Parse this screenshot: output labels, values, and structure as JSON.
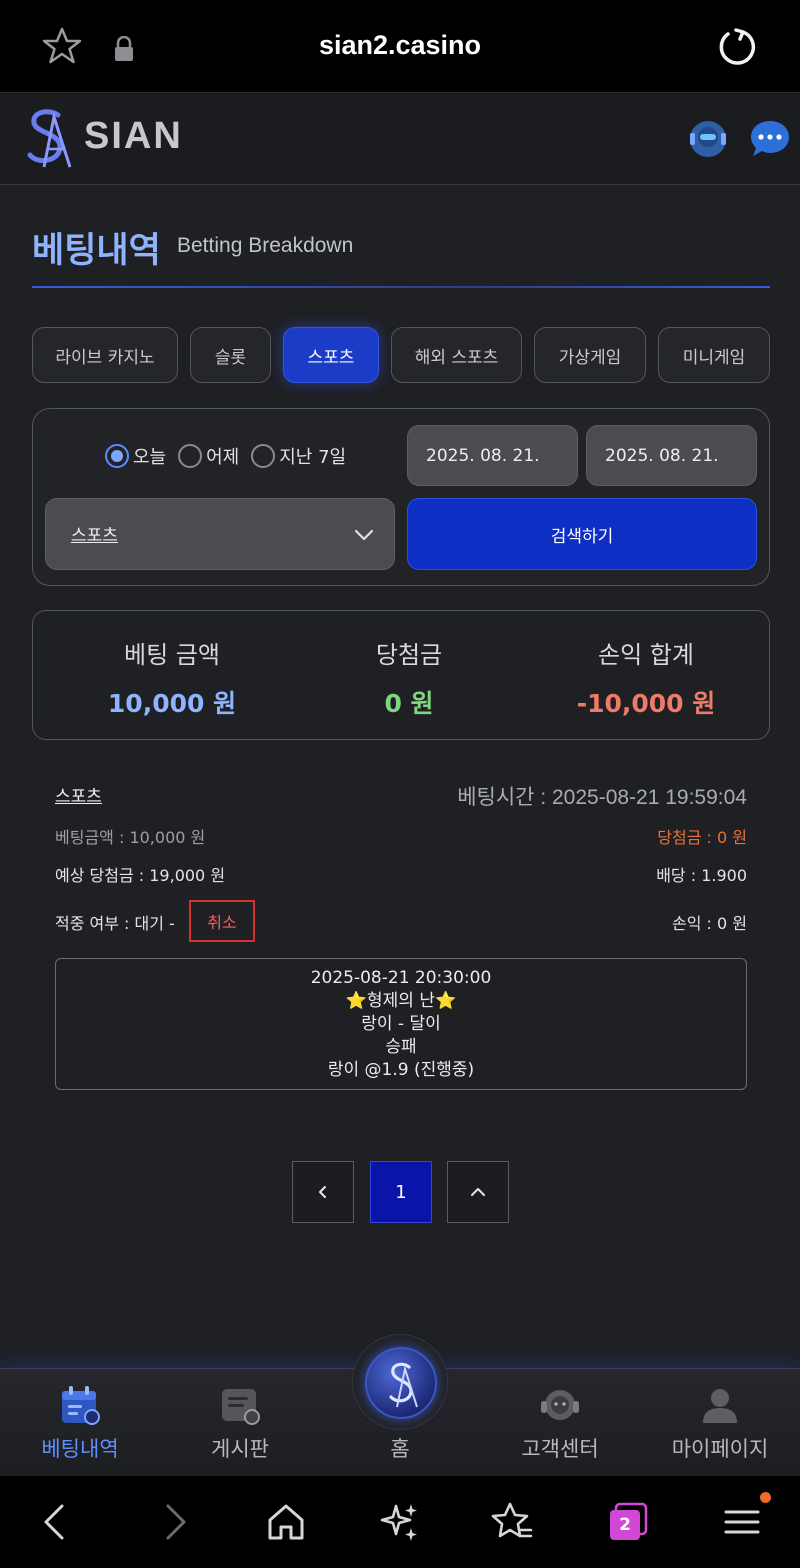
{
  "browser": {
    "url": "sian2.casino",
    "tab_count": "2"
  },
  "site": {
    "logo_text": "SIAN"
  },
  "page": {
    "title": "베팅내역",
    "subtitle": "Betting Breakdown"
  },
  "tabs": [
    {
      "label": "라이브 카지노",
      "active": false
    },
    {
      "label": "슬롯",
      "active": false
    },
    {
      "label": "스포츠",
      "active": true
    },
    {
      "label": "해외 스포츠",
      "active": false
    },
    {
      "label": "가상게임",
      "active": false
    },
    {
      "label": "미니게임",
      "active": false
    }
  ],
  "filter": {
    "radios": [
      {
        "label": "오늘",
        "checked": true
      },
      {
        "label": "어제",
        "checked": false
      },
      {
        "label": "지난 7일",
        "checked": false
      }
    ],
    "date_from": "2025. 08. 21.",
    "date_to": "2025. 08. 21.",
    "category_selected": "스포츠",
    "search_label": "검색하기"
  },
  "summary": {
    "bet_label": "베팅 금액",
    "bet_value": "10,000 원",
    "win_label": "당첨금",
    "win_value": "0 원",
    "profit_label": "손익 합계",
    "profit_value": "-10,000 원"
  },
  "bet": {
    "category": "스포츠",
    "time": "베팅시간 : 2025-08-21 19:59:04",
    "amount": "베팅금액 : 10,000 원",
    "win": "당첨금 : 0 원",
    "expected": "예상 당첨금 : 19,000 원",
    "odds": "배당 : 1.900",
    "status": "적중 여부 : 대기 -",
    "cancel_label": "취소",
    "profit": "손익 : 0 원",
    "detail": {
      "datetime": "2025-08-21 20:30:00",
      "event": "⭐형제의 난⭐",
      "match": "랑이 - 달이",
      "market": "승패",
      "pick": "랑이 @1.9 (진행중)"
    }
  },
  "pagination": {
    "current": "1"
  },
  "bottom_nav": [
    {
      "label": "베팅내역",
      "icon": "calendar-icon",
      "active": true
    },
    {
      "label": "게시판",
      "icon": "board-icon",
      "active": false
    },
    {
      "label": "홈",
      "icon": "home-logo-icon",
      "active": false
    },
    {
      "label": "고객센터",
      "icon": "support-agent-icon",
      "active": false
    },
    {
      "label": "마이페이지",
      "icon": "user-icon",
      "active": false
    }
  ],
  "colors": {
    "accent": "#1a3cc6",
    "bet_value": "#8fb4ff",
    "win_value": "#7ed67e",
    "profit_value": "#f07a6a",
    "win_text": "#e8703a",
    "cancel": "#d63030"
  }
}
